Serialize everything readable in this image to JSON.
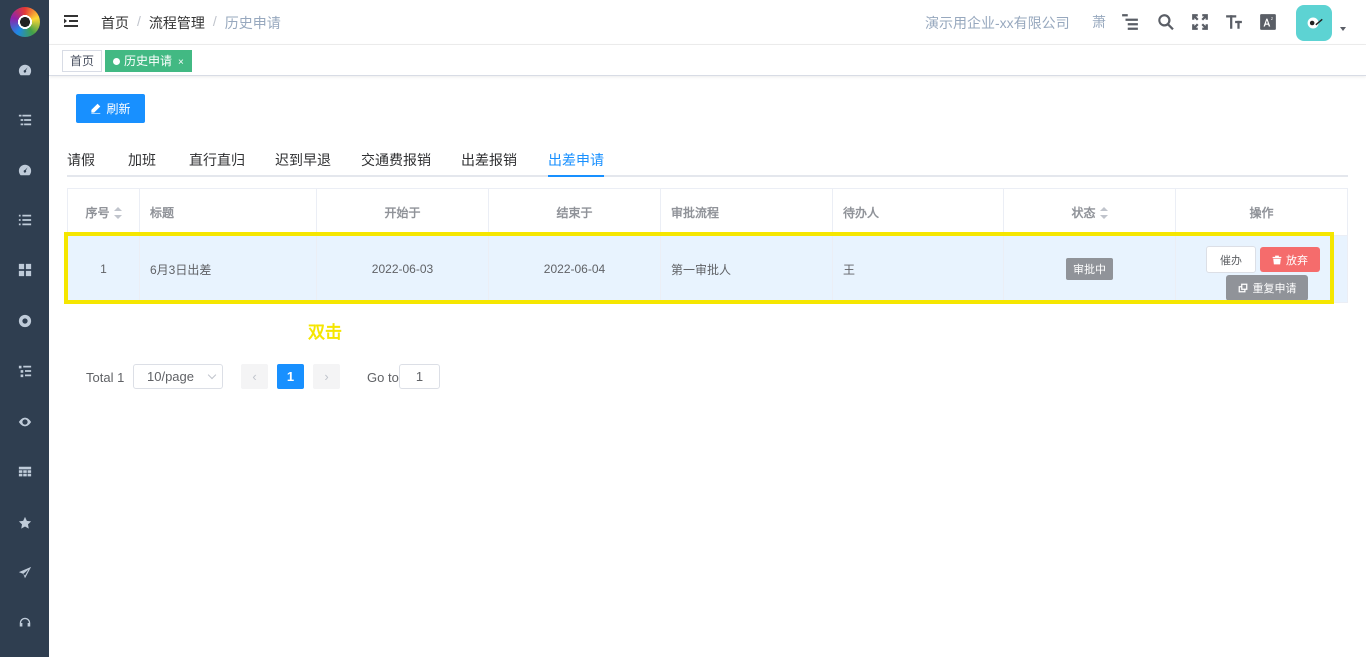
{
  "header": {
    "breadcrumb": [
      "首页",
      "流程管理",
      "历史申请"
    ],
    "breadcrumb_sep": "/",
    "company": "演示用企业-xx有限公司",
    "user_short": "萧"
  },
  "tagsbar": {
    "home": "首页",
    "active": "历史申请",
    "close": "×"
  },
  "toolbar": {
    "refresh_label": "刷新"
  },
  "tabs": [
    "请假",
    "加班",
    "直行直归",
    "迟到早退",
    "交通费报销",
    "出差报销",
    "出差申请"
  ],
  "active_tab": "出差申请",
  "table": {
    "headers": [
      "序号",
      "标题",
      "开始于",
      "结束于",
      "审批流程",
      "待办人",
      "状态",
      "操作"
    ],
    "rows": [
      {
        "index": "1",
        "title": "6月3日出差",
        "start": "2022-06-03",
        "end": "2022-06-04",
        "flow": "第一审批人",
        "assignee": "王",
        "status": "审批中",
        "actions": {
          "urge": "催办",
          "give_up": "放弃",
          "resubmit": "重复申请"
        }
      }
    ]
  },
  "annotation": "双击",
  "pagination": {
    "total": "Total 1",
    "page_size": "10/page",
    "current_page": "1",
    "goto_label": "Go to",
    "goto_value": "1"
  },
  "colors": {
    "primary": "#1890ff",
    "sidebar": "#2f3e50",
    "tag_active": "#42b983",
    "danger": "#f56c6c",
    "highlight": "#f5e600"
  }
}
